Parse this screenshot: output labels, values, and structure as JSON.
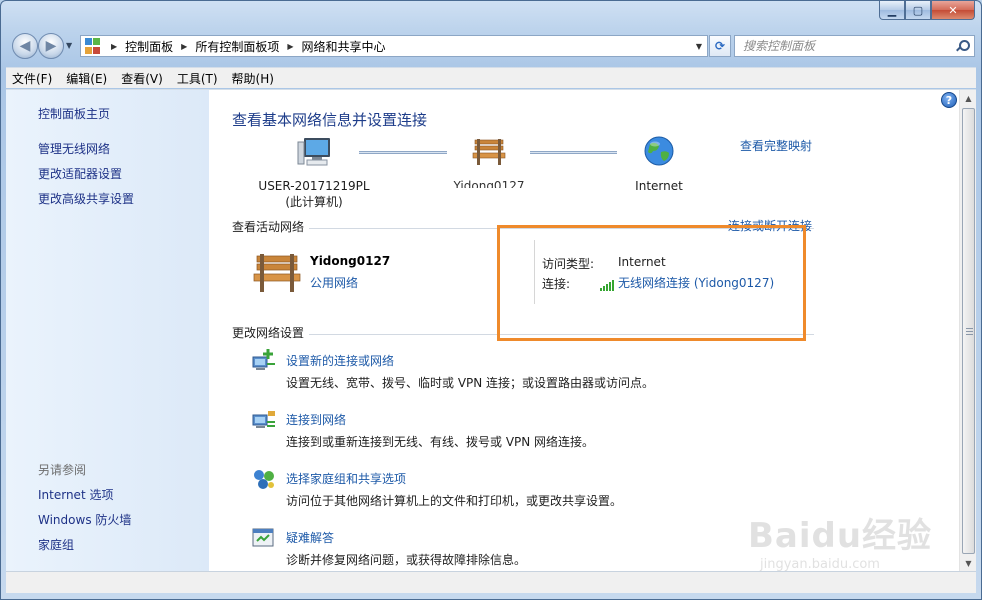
{
  "address_bar": {
    "breadcrumbs": [
      "控制面板",
      "所有控制面板项",
      "网络和共享中心"
    ]
  },
  "search": {
    "placeholder": "搜索控制面板"
  },
  "menu": [
    "文件(F)",
    "编辑(E)",
    "查看(V)",
    "工具(T)",
    "帮助(H)"
  ],
  "sidebar": {
    "home": "控制面板主页",
    "links": [
      "管理无线网络",
      "更改适配器设置",
      "更改高级共享设置"
    ],
    "see_also_label": "另请参阅",
    "see_also": [
      "Internet 选项",
      "Windows 防火墙",
      "家庭组"
    ]
  },
  "main": {
    "title": "查看基本网络信息并设置连接",
    "view_full_map": "查看完整映射",
    "map_nodes": [
      {
        "label_line1": "USER-20171219PL",
        "label_line2": "(此计算机)",
        "icon": "computer-icon"
      },
      {
        "label_line1": "Yidong0127",
        "icon": "bench-icon"
      },
      {
        "label_line1": "Internet",
        "icon": "globe-icon"
      }
    ],
    "active_networks": {
      "title": "查看活动网络",
      "toggle_link": "连接或断开连接",
      "network_name": "Yidong0127",
      "network_type": "公用网络",
      "access_type_label": "访问类型:",
      "access_type_value": "Internet",
      "connections_label": "连接:",
      "connections_value": "无线网络连接 (Yidong0127)"
    },
    "change_settings": {
      "title": "更改网络设置",
      "tasks": [
        {
          "link": "设置新的连接或网络",
          "desc": "设置无线、宽带、拨号、临时或 VPN 连接；或设置路由器或访问点。",
          "icon": "new-connection-icon"
        },
        {
          "link": "连接到网络",
          "desc": "连接到或重新连接到无线、有线、拨号或 VPN 网络连接。",
          "icon": "connect-network-icon"
        },
        {
          "link": "选择家庭组和共享选项",
          "desc": "访问位于其他网络计算机上的文件和打印机，或更改共享设置。",
          "icon": "homegroup-icon"
        },
        {
          "link": "疑难解答",
          "desc": "诊断并修复网络问题，或获得故障排除信息。",
          "icon": "troubleshoot-icon"
        }
      ]
    }
  },
  "watermark": {
    "main": "Baidu经验",
    "sub": "jingyan.baidu.com"
  },
  "colors": {
    "link": "#1e5aa8",
    "title": "#1e3d8a",
    "highlight": "#ef8a2b",
    "signal": "#35a631"
  }
}
